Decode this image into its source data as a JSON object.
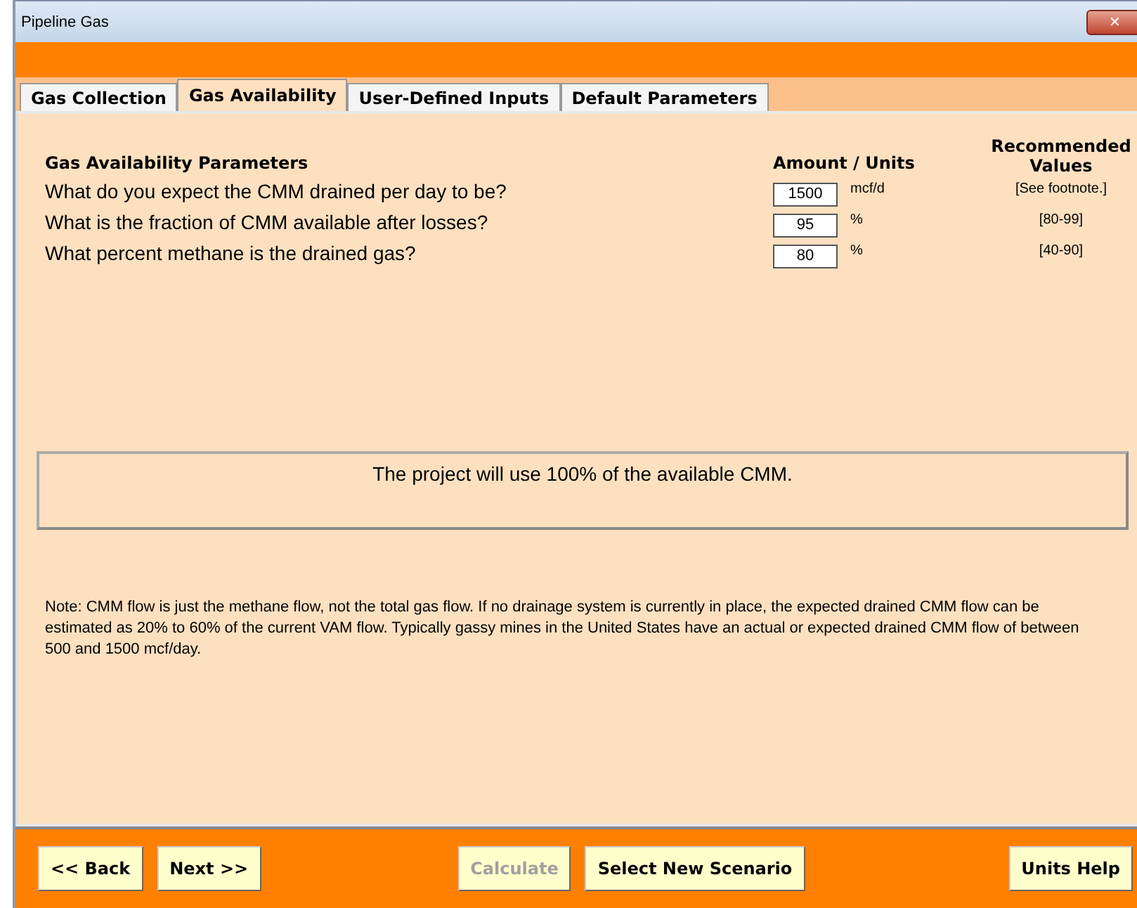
{
  "window": {
    "title": "Pipeline Gas",
    "close": "✕"
  },
  "tabs": [
    {
      "label": "Gas Collection",
      "selected": false
    },
    {
      "label": "Gas Availability",
      "selected": true
    },
    {
      "label": "User-Defined Inputs",
      "selected": false
    },
    {
      "label": "Default Parameters",
      "selected": false
    }
  ],
  "parameters": {
    "heading": "Gas Availability Parameters",
    "amount_heading": "Amount / Units",
    "recommended_heading": "Recommended Values",
    "rows": [
      {
        "question": "What do you expect the CMM drained per day to be?",
        "value": "1500",
        "unit": "mcf/d",
        "recommended": "[See footnote.]"
      },
      {
        "question": "What is the fraction of CMM available after losses?",
        "value": "95",
        "unit": "%",
        "recommended": "[80-99]"
      },
      {
        "question": "What percent methane is the drained gas?",
        "value": "80",
        "unit": "%",
        "recommended": "[40-90]"
      }
    ]
  },
  "result": "The project will use 100% of the available CMM.",
  "note": "Note: CMM flow is just the methane flow, not the total gas flow. If no drainage system is currently in place, the expected drained CMM flow can be estimated as 20% to 60% of the current VAM flow.  Typically gassy mines in the United States have an actual or expected drained CMM flow of between 500 and 1500 mcf/day.",
  "buttons": [
    {
      "label": "<< Back",
      "disabled": false
    },
    {
      "label": "Next >>",
      "disabled": false
    },
    {
      "label": "Calculate",
      "disabled": true
    },
    {
      "label": "Select New Scenario",
      "disabled": false
    },
    {
      "label": "Units Help",
      "disabled": false
    }
  ]
}
